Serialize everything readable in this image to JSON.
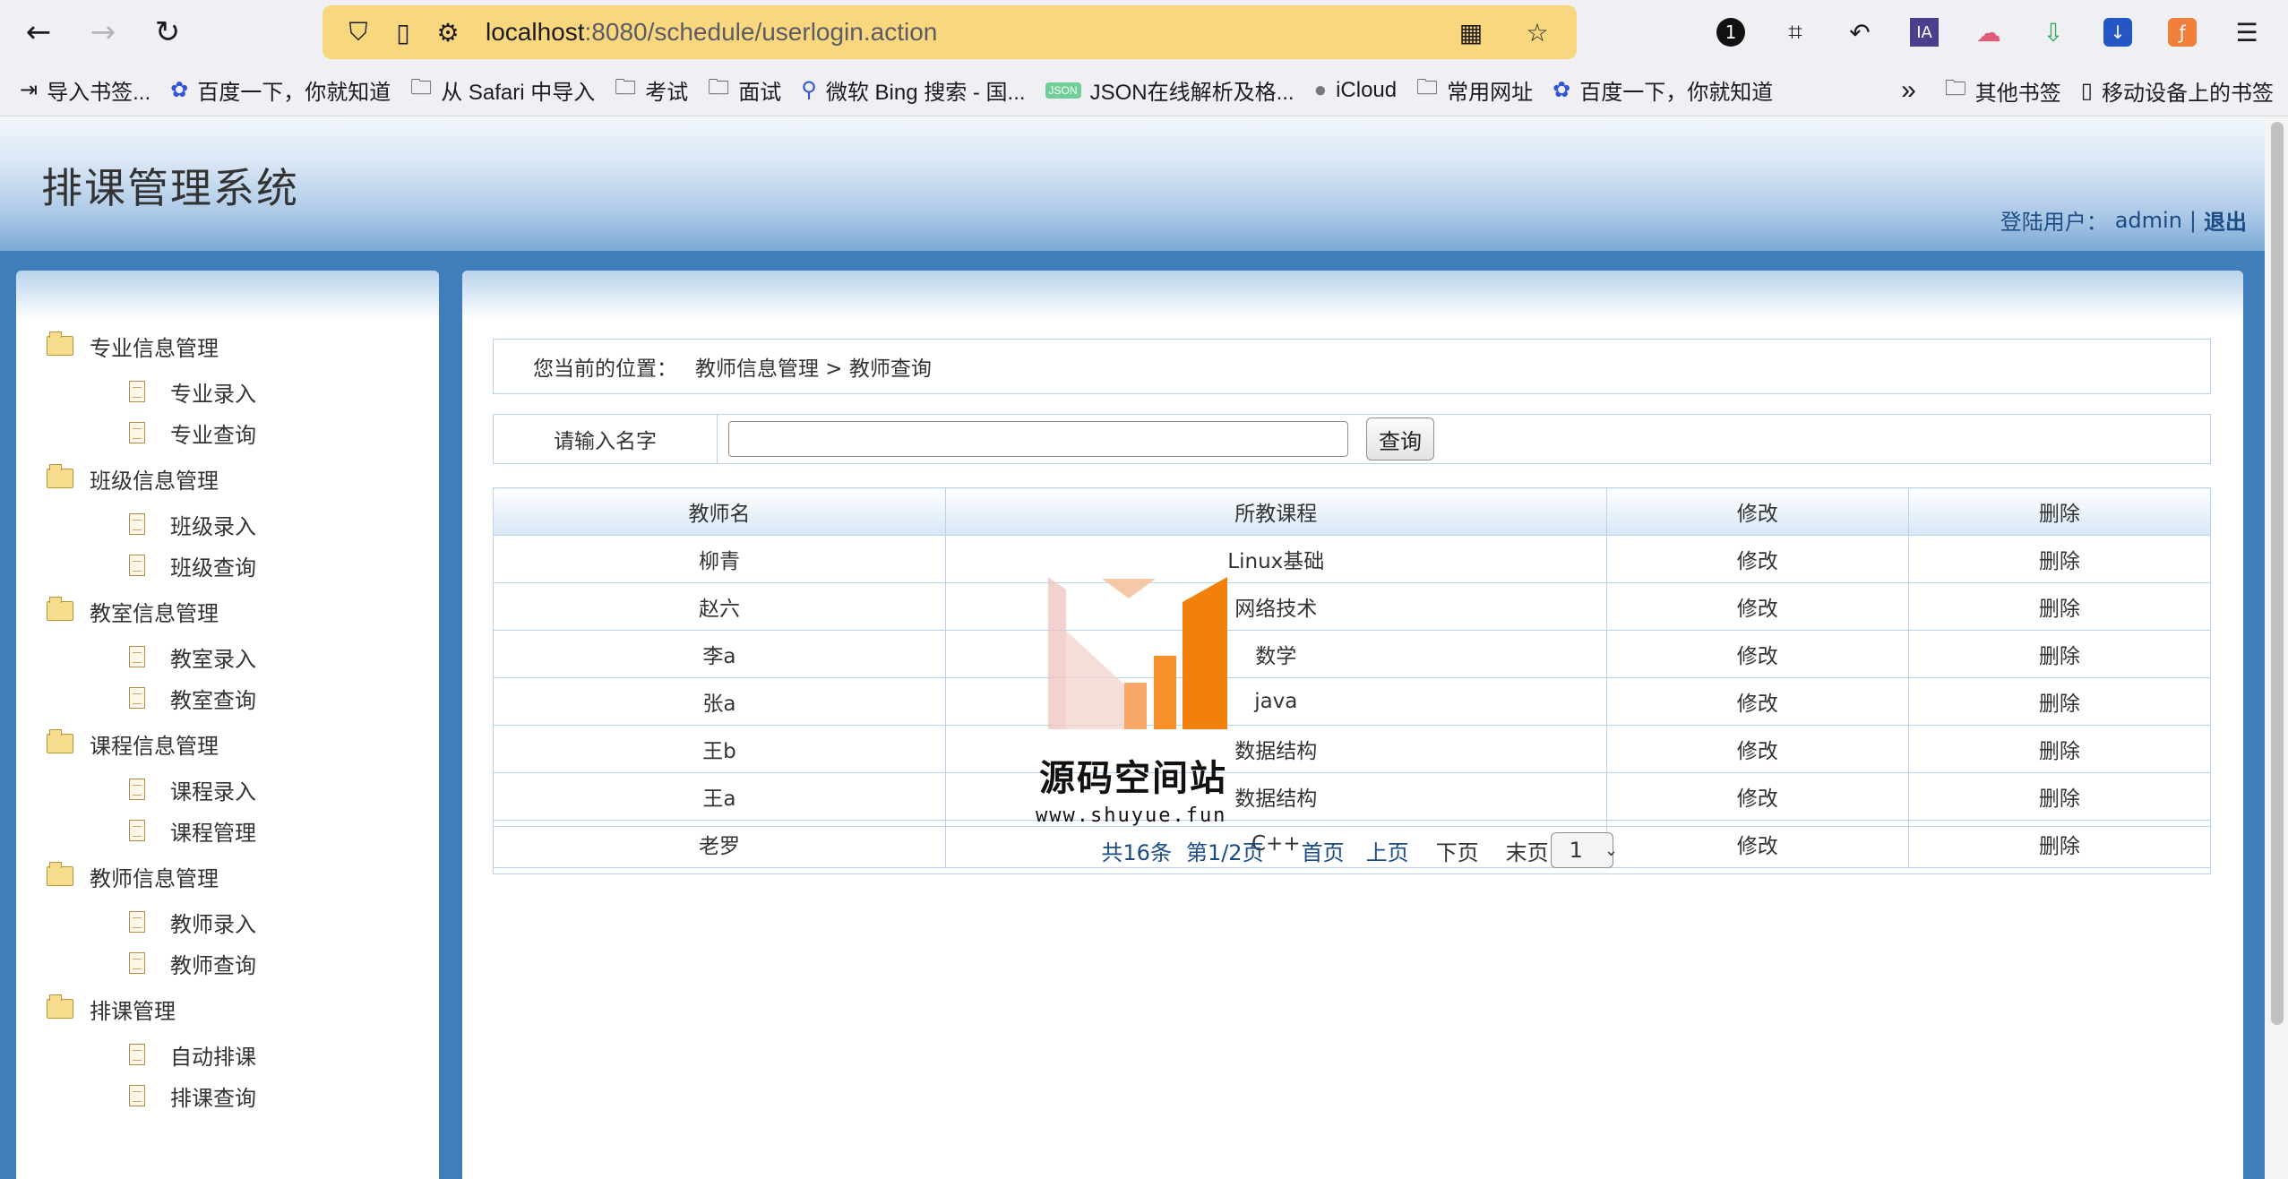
{
  "browser": {
    "url_host": "localhost",
    "url_rest": ":8080/schedule/userlogin.action",
    "bookmarks": [
      {
        "label": "导入书签...",
        "icon": "import-icon"
      },
      {
        "label": "百度一下，你就知道",
        "icon": "baidu-paw-icon"
      },
      {
        "label": "从 Safari 中导入",
        "icon": "folder-icon"
      },
      {
        "label": "考试",
        "icon": "folder-icon"
      },
      {
        "label": "面试",
        "icon": "folder-icon"
      },
      {
        "label": "微软 Bing 搜索 - 国...",
        "icon": "search-icon"
      },
      {
        "label": "JSON在线解析及格...",
        "icon": "json-icon"
      },
      {
        "label": "iCloud",
        "icon": "apple-icon"
      },
      {
        "label": "常用网址",
        "icon": "folder-icon"
      },
      {
        "label": "百度一下，你就知道",
        "icon": "baidu-paw-icon"
      }
    ],
    "bookmarks_right": [
      {
        "label": "其他书签",
        "icon": "folder-icon"
      },
      {
        "label": "移动设备上的书签",
        "icon": "mobile-icon"
      }
    ]
  },
  "app": {
    "title": "排课管理系统",
    "user_label": "登陆用户：",
    "username": "admin",
    "separator": "|",
    "logout": "退出"
  },
  "sidebar": {
    "groups": [
      {
        "label": "专业信息管理",
        "items": [
          "专业录入",
          "专业查询"
        ]
      },
      {
        "label": "班级信息管理",
        "items": [
          "班级录入",
          "班级查询"
        ]
      },
      {
        "label": "教室信息管理",
        "items": [
          "教室录入",
          "教室查询"
        ]
      },
      {
        "label": "课程信息管理",
        "items": [
          "课程录入",
          "课程管理"
        ]
      },
      {
        "label": "教师信息管理",
        "items": [
          "教师录入",
          "教师查询"
        ]
      },
      {
        "label": "排课管理",
        "items": [
          "自动排课",
          "排课查询"
        ]
      }
    ]
  },
  "main": {
    "location_label": "您当前的位置：",
    "location_path": "教师信息管理 > 教师查询",
    "search_label": "请输入名字",
    "search_value": "",
    "search_button": "查询",
    "table": {
      "headers": [
        "教师名",
        "所教课程",
        "修改",
        "删除"
      ],
      "rows": [
        [
          "柳青",
          "Linux基础",
          "修改",
          "删除"
        ],
        [
          "赵六",
          "网络技术",
          "修改",
          "删除"
        ],
        [
          "李a",
          "数学",
          "修改",
          "删除"
        ],
        [
          "张a",
          "java",
          "修改",
          "删除"
        ],
        [
          "王b",
          "数据结构",
          "修改",
          "删除"
        ],
        [
          "王a",
          "数据结构",
          "修改",
          "删除"
        ],
        [
          "老罗",
          "C++",
          "修改",
          "删除"
        ]
      ]
    },
    "pager": {
      "total": "共16条",
      "page_info": "第1/2页",
      "first": "首页",
      "prev": "上页",
      "next": "下页",
      "last": "末页",
      "select_value": "1"
    }
  },
  "watermark": {
    "text": "源码空间站",
    "url": "www.shuyue.fun"
  }
}
